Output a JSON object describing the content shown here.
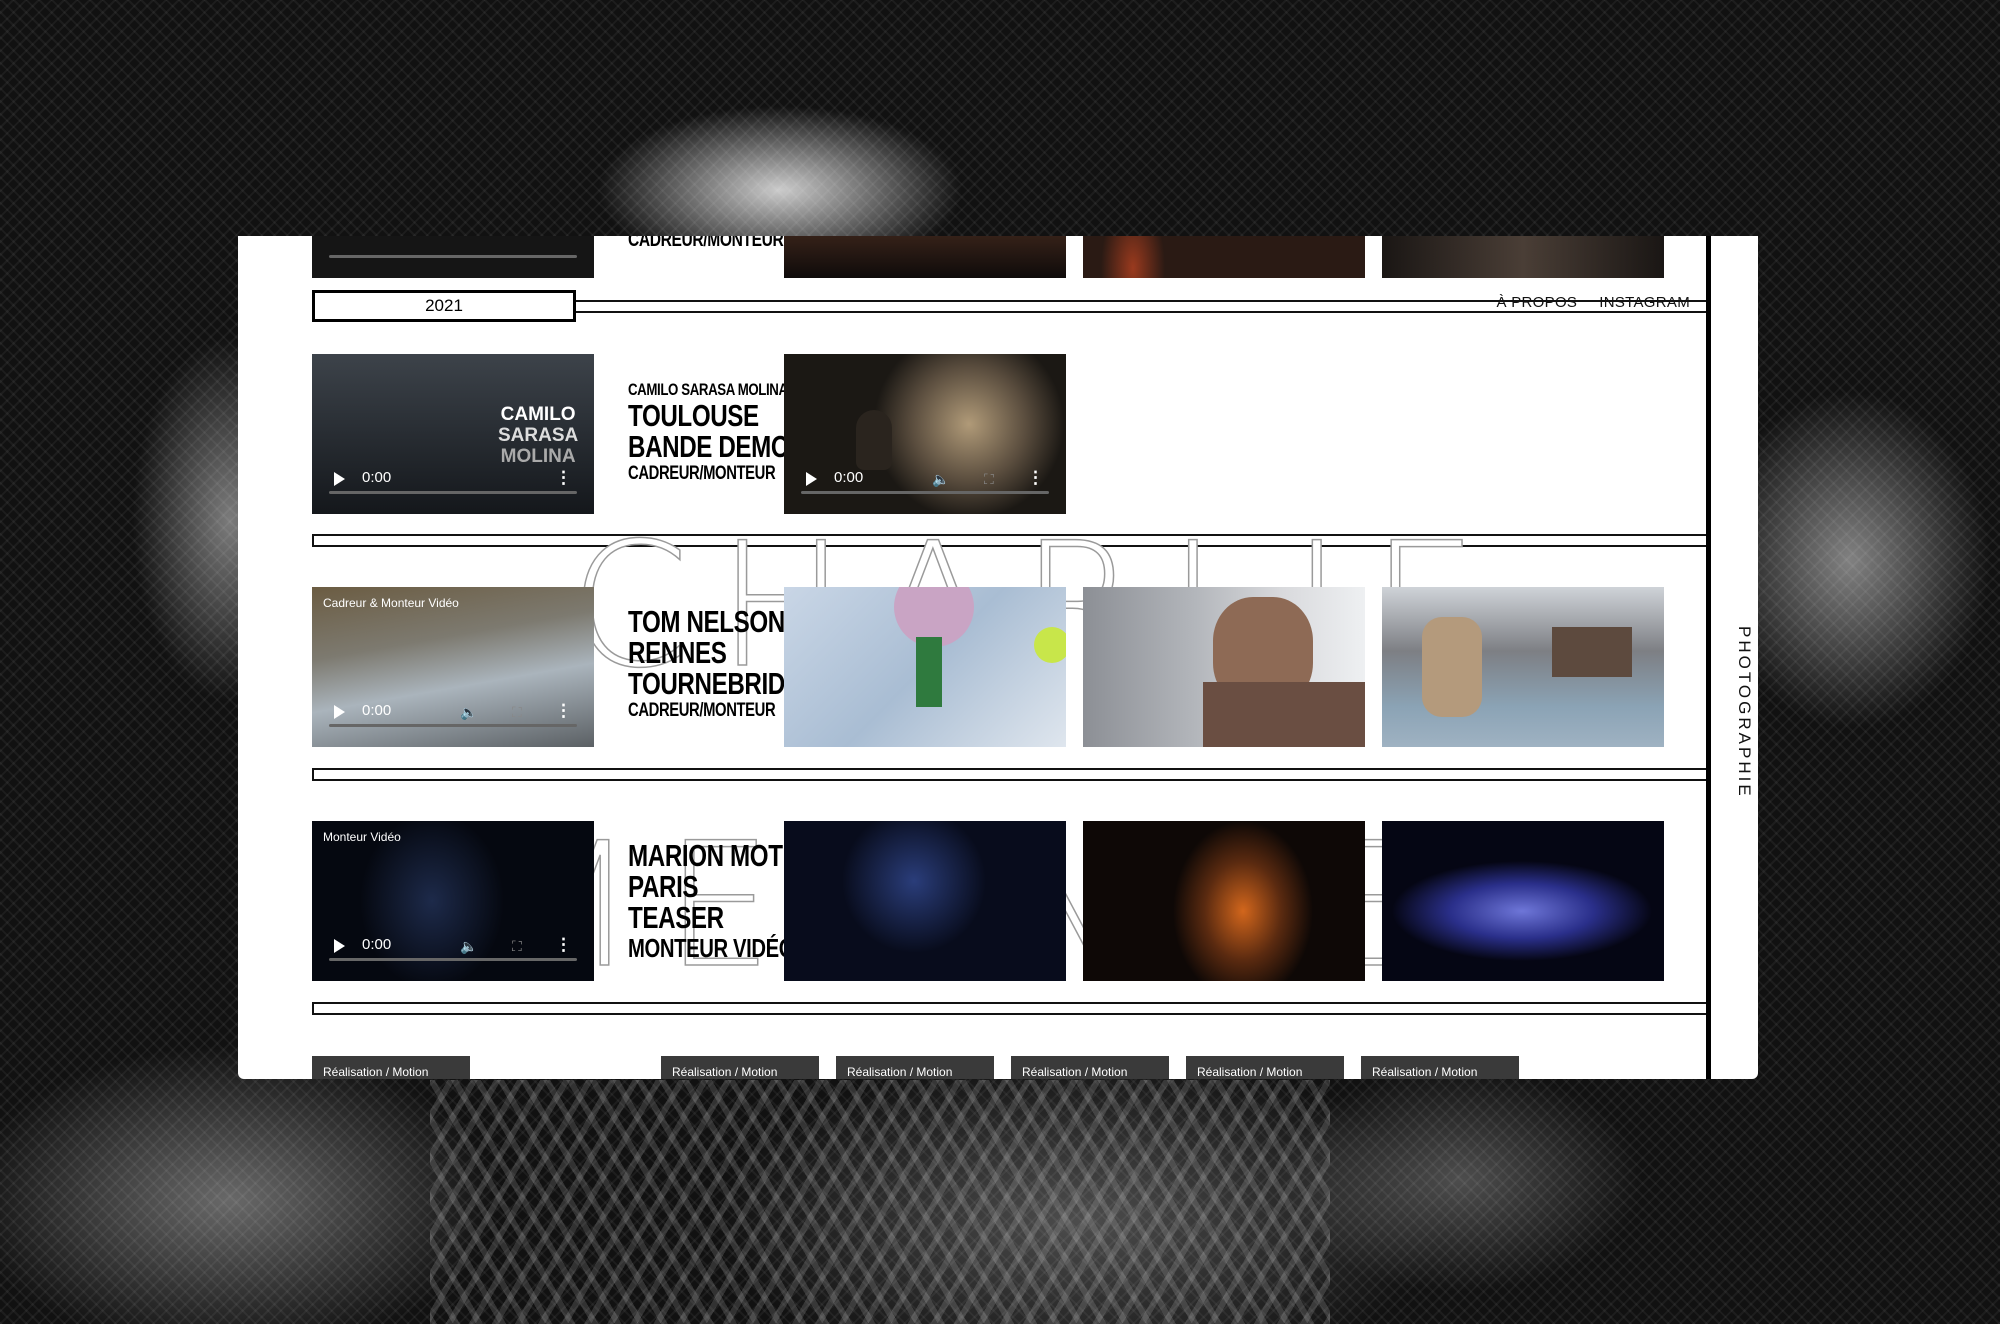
{
  "page": {
    "side_label": "PHOTOGRAPHIE",
    "big_name": "CHARLIE MELINHED"
  },
  "nav": {
    "year": "2021",
    "links": [
      "À PROPOS",
      "INSTAGRAM"
    ]
  },
  "top_row": {
    "label": "CADREUR/MONTEUR"
  },
  "projects": [
    {
      "video": {
        "caption": "",
        "time": "0:00",
        "overlay": [
          "CAMILO",
          "SARASA",
          "MOLINA"
        ]
      },
      "lines": [
        "CAMILO SARASA MOLINA",
        "TOULOUSE",
        "BANDE DEMO",
        "CADREUR/MONTEUR"
      ],
      "second_video_time": "0:00"
    },
    {
      "video": {
        "caption": "Cadreur & Monteur Vidéo",
        "time": "0:00"
      },
      "lines": [
        "TOM NELSON",
        "RENNES",
        "TOURNEBRIDE",
        "CADREUR/MONTEUR"
      ]
    },
    {
      "video": {
        "caption": "Monteur Vidéo",
        "time": "0:00"
      },
      "lines": [
        "MARION MOTIN",
        "PARIS",
        "TEASER",
        "MONTEUR VIDÉO"
      ]
    }
  ],
  "bottom_row": {
    "labels": [
      "Réalisation / Motion",
      "Réalisation / Motion",
      "Réalisation / Motion",
      "Réalisation / Motion",
      "Réalisation / Motion",
      "Réalisation / Motion"
    ]
  },
  "colors": {
    "page_bg": "#ffffff",
    "accent": "#000000",
    "outline_text": "#9a9a9a"
  }
}
